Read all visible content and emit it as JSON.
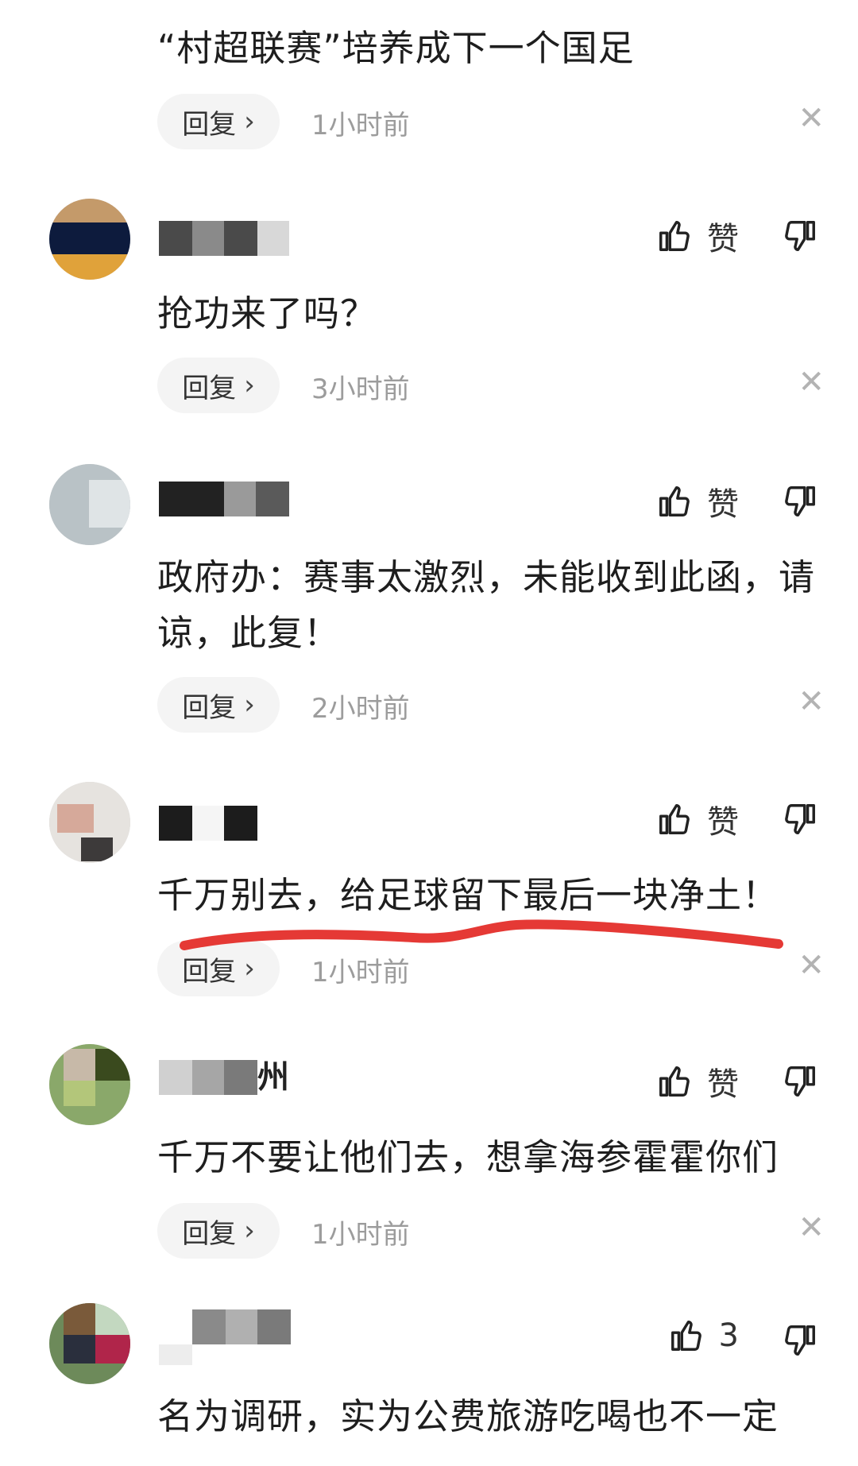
{
  "comments": [
    {
      "text": "“村超联赛”培养成下一个国足",
      "reply_label": "回复",
      "time": "1小时前"
    },
    {
      "text": "抢功来了吗？",
      "like_label": "赞",
      "reply_label": "回复",
      "time": "3小时前"
    },
    {
      "text": "政府办：赛事太激烈，未能收到此函，请谅，此复！",
      "like_label": "赞",
      "reply_label": "回复",
      "time": "2小时前"
    },
    {
      "text": "千万别去，给足球留下最后一块净土！",
      "like_label": "赞",
      "reply_label": "回复",
      "time": "1小时前"
    },
    {
      "username_visible": "州",
      "text": "千万不要让他们去，想拿海参霍霍你们",
      "like_label": "赞",
      "reply_label": "回复",
      "time": "1小时前"
    },
    {
      "text": "名为调研，实为公费旅游吃喝也不一定",
      "like_count": "3"
    }
  ],
  "colors": {
    "annotation_underline": "#e53935",
    "text": "#1e1e1e",
    "muted": "#9c9c9c"
  }
}
